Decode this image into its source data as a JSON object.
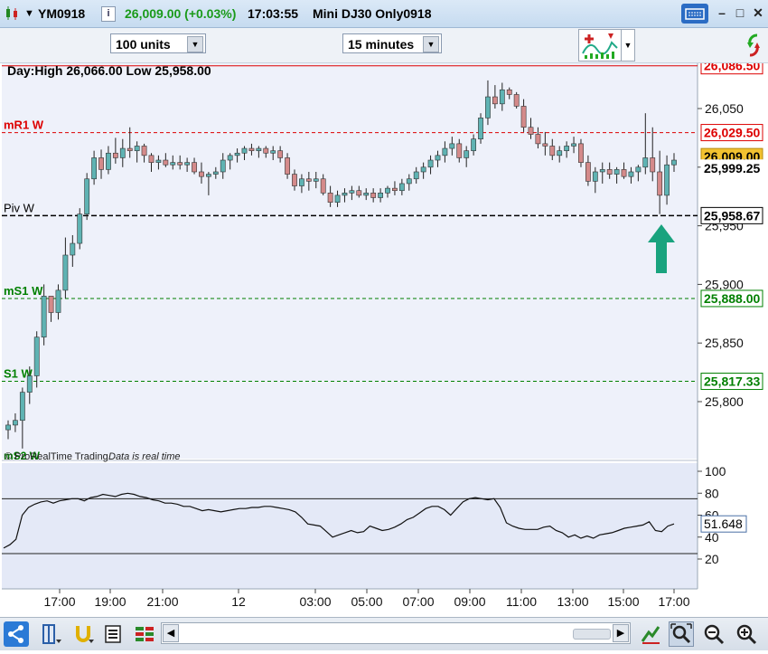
{
  "titlebar": {
    "symbol": "YM0918",
    "last": "26,009.00 (+0.03%)",
    "time": "17:03:55",
    "instrument": "Mini DJ30 Only0918"
  },
  "toolbar": {
    "units": "100 units",
    "interval": "15 minutes"
  },
  "chart": {
    "day_range": "Day:High 26,066.00 Low 25,958.00",
    "levels": [
      {
        "name": "",
        "value": 26086.5,
        "tag": "26,086.50",
        "color": "#dd0000",
        "dash": "none"
      },
      {
        "name": "mR1 W",
        "value": 26029.5,
        "tag": "26,029.50",
        "color": "#dd0000",
        "dash": "4,3"
      },
      {
        "name": "Piv W",
        "value": 25958.67,
        "tag": "25,958.67",
        "color": "#000000",
        "dash": "6,3"
      },
      {
        "name": "mS1 W",
        "value": 25888.0,
        "tag": "25,888.00",
        "color": "#008000",
        "dash": "4,3"
      },
      {
        "name": "S1 W",
        "value": 25817.33,
        "tag": "25,817.33",
        "color": "#008000",
        "dash": "4,3"
      }
    ],
    "price_ticks": [
      "26,050",
      "26,000",
      "25,950",
      "25,900",
      "25,850",
      "25,800"
    ],
    "price_tick_values": [
      26050,
      26000,
      25950,
      25900,
      25850,
      25800
    ],
    "last_price_tag": "26,009.00",
    "bid_tag": "25,999.25",
    "footer_label": "mS2 W",
    "footer_brand": "© ProRealTime Trading",
    "footer_status": "Data is real time"
  },
  "oscillator": {
    "ticks": [
      "100",
      "80",
      "60",
      "40",
      "20"
    ],
    "tick_values": [
      100,
      80,
      60,
      40,
      20
    ],
    "upper_band": 75,
    "lower_band": 25,
    "last_tag": "51.648",
    "values": [
      30,
      33,
      38,
      60,
      67,
      70,
      72,
      73,
      71,
      73,
      74,
      75,
      75,
      73,
      76,
      77,
      79,
      78,
      77,
      79,
      80,
      79,
      77,
      76,
      74,
      73,
      71,
      71,
      70,
      68,
      68,
      66,
      64,
      65,
      64,
      63,
      64,
      65,
      66,
      66,
      67,
      67,
      68,
      68,
      67,
      66,
      65,
      63,
      58,
      52,
      51,
      50,
      45,
      40,
      42,
      44,
      46,
      44,
      45,
      50,
      48,
      46,
      47,
      49,
      52,
      56,
      58,
      62,
      66,
      68,
      68,
      65,
      60,
      66,
      72,
      75,
      76,
      75,
      74,
      75,
      67,
      53,
      50,
      48,
      47,
      47,
      47,
      49,
      50,
      46,
      44,
      40,
      42,
      39,
      41,
      39,
      42,
      43,
      44,
      46,
      48,
      49,
      50,
      51,
      54,
      46,
      45,
      50,
      52
    ]
  },
  "time_axis": [
    "17:00",
    "19:00",
    "21:00",
    "12",
    "03:00",
    "05:00",
    "07:00",
    "09:00",
    "11:00",
    "13:00",
    "15:00",
    "17:00"
  ],
  "candles": [
    {
      "o": 25776,
      "h": 25784,
      "l": 25768,
      "c": 25780
    },
    {
      "o": 25780,
      "h": 25790,
      "l": 25774,
      "c": 25784
    },
    {
      "o": 25784,
      "h": 25812,
      "l": 25760,
      "c": 25808
    },
    {
      "o": 25808,
      "h": 25830,
      "l": 25798,
      "c": 25822
    },
    {
      "o": 25822,
      "h": 25860,
      "l": 25812,
      "c": 25855
    },
    {
      "o": 25855,
      "h": 25900,
      "l": 25848,
      "c": 25890
    },
    {
      "o": 25890,
      "h": 25890,
      "l": 25868,
      "c": 25876
    },
    {
      "o": 25876,
      "h": 25900,
      "l": 25870,
      "c": 25895
    },
    {
      "o": 25895,
      "h": 25940,
      "l": 25888,
      "c": 25925
    },
    {
      "o": 25925,
      "h": 25942,
      "l": 25915,
      "c": 25935
    },
    {
      "o": 25935,
      "h": 25965,
      "l": 25930,
      "c": 25960
    },
    {
      "o": 25960,
      "h": 25995,
      "l": 25955,
      "c": 25990
    },
    {
      "o": 25990,
      "h": 26014,
      "l": 25985,
      "c": 26008
    },
    {
      "o": 26008,
      "h": 26015,
      "l": 25990,
      "c": 25998
    },
    {
      "o": 25998,
      "h": 26018,
      "l": 25994,
      "c": 26012
    },
    {
      "o": 26012,
      "h": 26025,
      "l": 26003,
      "c": 26008
    },
    {
      "o": 26008,
      "h": 26024,
      "l": 26000,
      "c": 26016
    },
    {
      "o": 26016,
      "h": 26034,
      "l": 26008,
      "c": 26014
    },
    {
      "o": 26014,
      "h": 26022,
      "l": 26004,
      "c": 26018
    },
    {
      "o": 26018,
      "h": 26020,
      "l": 26004,
      "c": 26010
    },
    {
      "o": 26010,
      "h": 26012,
      "l": 25996,
      "c": 26004
    },
    {
      "o": 26004,
      "h": 26010,
      "l": 25998,
      "c": 26006
    },
    {
      "o": 26006,
      "h": 26012,
      "l": 26000,
      "c": 26002
    },
    {
      "o": 26002,
      "h": 26010,
      "l": 25998,
      "c": 26004
    },
    {
      "o": 26004,
      "h": 26010,
      "l": 25998,
      "c": 26002
    },
    {
      "o": 26002,
      "h": 26008,
      "l": 25996,
      "c": 26004
    },
    {
      "o": 26004,
      "h": 26008,
      "l": 25994,
      "c": 25996
    },
    {
      "o": 25996,
      "h": 26004,
      "l": 25986,
      "c": 25992
    },
    {
      "o": 25992,
      "h": 25996,
      "l": 25976,
      "c": 25994
    },
    {
      "o": 25994,
      "h": 26000,
      "l": 25990,
      "c": 25996
    },
    {
      "o": 25996,
      "h": 26012,
      "l": 25990,
      "c": 26006
    },
    {
      "o": 26006,
      "h": 26012,
      "l": 25998,
      "c": 26010
    },
    {
      "o": 26010,
      "h": 26016,
      "l": 26004,
      "c": 26012
    },
    {
      "o": 26012,
      "h": 26018,
      "l": 26006,
      "c": 26016
    },
    {
      "o": 26016,
      "h": 26020,
      "l": 26010,
      "c": 26014
    },
    {
      "o": 26014,
      "h": 26018,
      "l": 26008,
      "c": 26016
    },
    {
      "o": 26016,
      "h": 26018,
      "l": 26008,
      "c": 26012
    },
    {
      "o": 26012,
      "h": 26018,
      "l": 26006,
      "c": 26014
    },
    {
      "o": 26014,
      "h": 26018,
      "l": 26004,
      "c": 26008
    },
    {
      "o": 26008,
      "h": 26012,
      "l": 25990,
      "c": 25994
    },
    {
      "o": 25994,
      "h": 25998,
      "l": 25980,
      "c": 25984
    },
    {
      "o": 25984,
      "h": 25994,
      "l": 25978,
      "c": 25990
    },
    {
      "o": 25990,
      "h": 25996,
      "l": 25980,
      "c": 25988
    },
    {
      "o": 25988,
      "h": 25996,
      "l": 25982,
      "c": 25990
    },
    {
      "o": 25990,
      "h": 25994,
      "l": 25976,
      "c": 25978
    },
    {
      "o": 25978,
      "h": 25984,
      "l": 25966,
      "c": 25970
    },
    {
      "o": 25970,
      "h": 25980,
      "l": 25966,
      "c": 25976
    },
    {
      "o": 25976,
      "h": 25982,
      "l": 25970,
      "c": 25978
    },
    {
      "o": 25978,
      "h": 25984,
      "l": 25972,
      "c": 25980
    },
    {
      "o": 25980,
      "h": 25984,
      "l": 25974,
      "c": 25976
    },
    {
      "o": 25976,
      "h": 25982,
      "l": 25972,
      "c": 25978
    },
    {
      "o": 25978,
      "h": 25982,
      "l": 25970,
      "c": 25974
    },
    {
      "o": 25974,
      "h": 25982,
      "l": 25970,
      "c": 25978
    },
    {
      "o": 25978,
      "h": 25984,
      "l": 25974,
      "c": 25982
    },
    {
      "o": 25982,
      "h": 25988,
      "l": 25976,
      "c": 25980
    },
    {
      "o": 25980,
      "h": 25990,
      "l": 25976,
      "c": 25986
    },
    {
      "o": 25986,
      "h": 25994,
      "l": 25980,
      "c": 25990
    },
    {
      "o": 25990,
      "h": 26000,
      "l": 25986,
      "c": 25996
    },
    {
      "o": 25996,
      "h": 26004,
      "l": 25990,
      "c": 26000
    },
    {
      "o": 26000,
      "h": 26010,
      "l": 25994,
      "c": 26006
    },
    {
      "o": 26006,
      "h": 26014,
      "l": 26000,
      "c": 26010
    },
    {
      "o": 26010,
      "h": 26022,
      "l": 26004,
      "c": 26016
    },
    {
      "o": 26016,
      "h": 26026,
      "l": 26010,
      "c": 26020
    },
    {
      "o": 26020,
      "h": 26024,
      "l": 26004,
      "c": 26008
    },
    {
      "o": 26008,
      "h": 26018,
      "l": 26000,
      "c": 26014
    },
    {
      "o": 26014,
      "h": 26028,
      "l": 26010,
      "c": 26024
    },
    {
      "o": 26024,
      "h": 26046,
      "l": 26020,
      "c": 26042
    },
    {
      "o": 26042,
      "h": 26074,
      "l": 26036,
      "c": 26060
    },
    {
      "o": 26060,
      "h": 26070,
      "l": 26050,
      "c": 26054
    },
    {
      "o": 26054,
      "h": 26072,
      "l": 26048,
      "c": 26066
    },
    {
      "o": 26066,
      "h": 26068,
      "l": 26058,
      "c": 26062
    },
    {
      "o": 26062,
      "h": 26064,
      "l": 26050,
      "c": 26052
    },
    {
      "o": 26052,
      "h": 26058,
      "l": 26030,
      "c": 26034
    },
    {
      "o": 26034,
      "h": 26042,
      "l": 26024,
      "c": 26028
    },
    {
      "o": 26028,
      "h": 26034,
      "l": 26016,
      "c": 26020
    },
    {
      "o": 26020,
      "h": 26030,
      "l": 26010,
      "c": 26018
    },
    {
      "o": 26018,
      "h": 26024,
      "l": 26006,
      "c": 26010
    },
    {
      "o": 26010,
      "h": 26018,
      "l": 26004,
      "c": 26014
    },
    {
      "o": 26014,
      "h": 26022,
      "l": 26008,
      "c": 26018
    },
    {
      "o": 26018,
      "h": 26026,
      "l": 26012,
      "c": 26020
    },
    {
      "o": 26020,
      "h": 26024,
      "l": 26000,
      "c": 26004
    },
    {
      "o": 26004,
      "h": 26010,
      "l": 25984,
      "c": 25988
    },
    {
      "o": 25988,
      "h": 26000,
      "l": 25978,
      "c": 25996
    },
    {
      "o": 25996,
      "h": 26004,
      "l": 25986,
      "c": 25998
    },
    {
      "o": 25998,
      "h": 26004,
      "l": 25990,
      "c": 25994
    },
    {
      "o": 25994,
      "h": 26000,
      "l": 25986,
      "c": 25998
    },
    {
      "o": 25998,
      "h": 26004,
      "l": 25990,
      "c": 25992
    },
    {
      "o": 25992,
      "h": 26000,
      "l": 25986,
      "c": 25996
    },
    {
      "o": 25996,
      "h": 26002,
      "l": 25988,
      "c": 26000
    },
    {
      "o": 26000,
      "h": 26046,
      "l": 25994,
      "c": 26008
    },
    {
      "o": 26008,
      "h": 26034,
      "l": 25988,
      "c": 25996
    },
    {
      "o": 25996,
      "h": 26014,
      "l": 25960,
      "c": 25976
    },
    {
      "o": 25976,
      "h": 26010,
      "l": 25968,
      "c": 26002
    },
    {
      "o": 26002,
      "h": 26012,
      "l": 25996,
      "c": 26006
    }
  ]
}
